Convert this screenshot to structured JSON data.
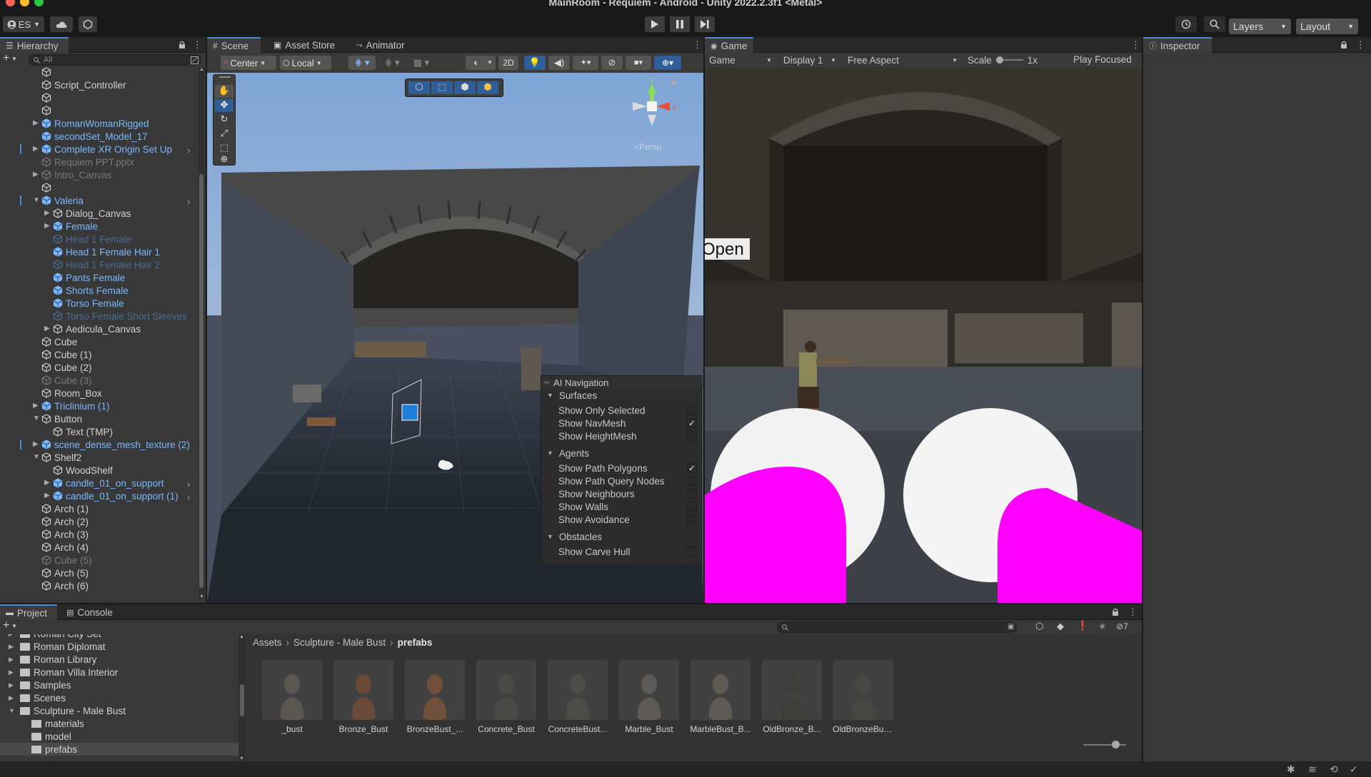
{
  "window": {
    "title": "MainRoom - Requiem - Android - Unity 2022.2.3f1 <Metal>"
  },
  "toolbar": {
    "account": "ES",
    "layers": "Layers",
    "layout": "Layout"
  },
  "hierarchy": {
    "tab": "Hierarchy",
    "search_placeholder": "All",
    "rows": [
      {
        "label": "",
        "depth": 1,
        "style": "normal"
      },
      {
        "label": "Script_Controller",
        "depth": 1,
        "style": "normal"
      },
      {
        "label": "",
        "depth": 1,
        "style": "normal"
      },
      {
        "label": "",
        "depth": 1,
        "style": "normal"
      },
      {
        "label": "RomanWomanRigged",
        "depth": 1,
        "style": "blue",
        "arrow": true
      },
      {
        "label": "secondSet_Model_17",
        "depth": 1,
        "style": "blue"
      },
      {
        "label": "Complete XR Origin Set Up",
        "depth": 1,
        "style": "blue",
        "arrow": true,
        "more": true
      },
      {
        "label": "Requiem PPT.pptx",
        "depth": 1,
        "style": "dim"
      },
      {
        "label": "Intro_Canvas",
        "depth": 1,
        "style": "dim",
        "arrow": true
      },
      {
        "label": "",
        "depth": 1,
        "style": "normal"
      },
      {
        "label": "Valeria",
        "depth": 1,
        "style": "blue",
        "arrow": true,
        "open": true,
        "more": true
      },
      {
        "label": "Dialog_Canvas",
        "depth": 2,
        "style": "normal",
        "arrow": true
      },
      {
        "label": "Female",
        "depth": 2,
        "style": "blue",
        "arrow": true
      },
      {
        "label": "Head 1 Female",
        "depth": 2,
        "style": "dimblue"
      },
      {
        "label": "Head 1 Female Hair 1",
        "depth": 2,
        "style": "blue"
      },
      {
        "label": "Head 1 Female Hair 2",
        "depth": 2,
        "style": "dimblue"
      },
      {
        "label": "Pants Female",
        "depth": 2,
        "style": "blue"
      },
      {
        "label": "Shorts Female",
        "depth": 2,
        "style": "blue"
      },
      {
        "label": "Torso Female",
        "depth": 2,
        "style": "blue"
      },
      {
        "label": "Torso Female Short Sleeves",
        "depth": 2,
        "style": "dimblue"
      },
      {
        "label": "Aedicula_Canvas",
        "depth": 2,
        "style": "normal",
        "arrow": true
      },
      {
        "label": "Cube",
        "depth": 1,
        "style": "normal"
      },
      {
        "label": "Cube (1)",
        "depth": 1,
        "style": "normal"
      },
      {
        "label": "Cube (2)",
        "depth": 1,
        "style": "normal"
      },
      {
        "label": "Cube (3)",
        "depth": 1,
        "style": "dim"
      },
      {
        "label": "Room_Box",
        "depth": 1,
        "style": "normal"
      },
      {
        "label": "Triclinium (1)",
        "depth": 1,
        "style": "blue",
        "arrow": true
      },
      {
        "label": "Button",
        "depth": 1,
        "style": "normal",
        "arrow": true,
        "open": true
      },
      {
        "label": "Text (TMP)",
        "depth": 2,
        "style": "normal"
      },
      {
        "label": "scene_dense_mesh_texture (2)",
        "depth": 1,
        "style": "blue",
        "arrow": true
      },
      {
        "label": "Shelf2",
        "depth": 1,
        "style": "normal",
        "arrow": true,
        "open": true
      },
      {
        "label": "WoodShelf",
        "depth": 2,
        "style": "normal"
      },
      {
        "label": "candle_01_on_support",
        "depth": 2,
        "style": "blue",
        "arrow": true,
        "more": true
      },
      {
        "label": "candle_01_on_support (1)",
        "depth": 2,
        "style": "blue",
        "arrow": true,
        "more": true
      },
      {
        "label": "Arch (1)",
        "depth": 1,
        "style": "normal"
      },
      {
        "label": "Arch (2)",
        "depth": 1,
        "style": "normal"
      },
      {
        "label": "Arch (3)",
        "depth": 1,
        "style": "normal"
      },
      {
        "label": "Arch (4)",
        "depth": 1,
        "style": "normal"
      },
      {
        "label": "Cube (5)",
        "depth": 1,
        "style": "dim"
      },
      {
        "label": "Arch (5)",
        "depth": 1,
        "style": "normal"
      },
      {
        "label": "Arch (6)",
        "depth": 1,
        "style": "normal"
      }
    ]
  },
  "scene": {
    "tabs": [
      "Scene",
      "Asset Store",
      "Animator"
    ],
    "pivot": "Center",
    "space": "Local",
    "mode2d": "2D",
    "persp": "Persp",
    "ai_nav": {
      "title": "AI Navigation",
      "sections": [
        {
          "name": "Surfaces",
          "items": [
            {
              "label": "Show Only Selected",
              "checked": false
            },
            {
              "label": "Show NavMesh",
              "checked": true
            },
            {
              "label": "Show HeightMesh",
              "checked": false
            }
          ]
        },
        {
          "name": "Agents",
          "items": [
            {
              "label": "Show Path Polygons",
              "checked": true
            },
            {
              "label": "Show Path Query Nodes",
              "checked": false
            },
            {
              "label": "Show Neighbours",
              "checked": false
            },
            {
              "label": "Show Walls",
              "checked": false
            },
            {
              "label": "Show Avoidance",
              "checked": false
            }
          ]
        },
        {
          "name": "Obstacles",
          "items": [
            {
              "label": "Show Carve Hull",
              "checked": false
            }
          ]
        }
      ]
    }
  },
  "game": {
    "tab": "Game",
    "view": "Game",
    "display": "Display 1",
    "aspect": "Free Aspect",
    "scale_label": "Scale",
    "scale_value": "1x",
    "play_mode": "Play Focused",
    "sign_text": "Open"
  },
  "inspector": {
    "tab": "Inspector"
  },
  "project": {
    "tabs": [
      "Project",
      "Console"
    ],
    "hidden_count": "7",
    "folders": [
      {
        "label": "Roman City Set",
        "depth": 1
      },
      {
        "label": "Roman Diplomat",
        "depth": 1
      },
      {
        "label": "Roman Library",
        "depth": 1
      },
      {
        "label": "Roman Villa Interior",
        "depth": 1
      },
      {
        "label": "Samples",
        "depth": 1
      },
      {
        "label": "Scenes",
        "depth": 1
      },
      {
        "label": "Sculpture - Male Bust",
        "depth": 1,
        "open": true
      },
      {
        "label": "materials",
        "depth": 2
      },
      {
        "label": "model",
        "depth": 2
      },
      {
        "label": "prefabs",
        "depth": 2,
        "selected": true
      }
    ],
    "breadcrumb": [
      "Assets",
      "Sculpture - Male Bust",
      "prefabs"
    ],
    "assets": [
      {
        "label": "_bust",
        "tone": "#5a5650"
      },
      {
        "label": "Bronze_Bust",
        "tone": "#6a4a36"
      },
      {
        "label": "BronzeBust_...",
        "tone": "#70503a"
      },
      {
        "label": "Concrete_Bust",
        "tone": "#4a4a48"
      },
      {
        "label": "ConcreteBust...",
        "tone": "#4c4c4a"
      },
      {
        "label": "Marble_Bust",
        "tone": "#5c5a56"
      },
      {
        "label": "MarbleBust_B...",
        "tone": "#5e5a54"
      },
      {
        "label": "OldBronze_B...",
        "tone": "#3e3e3a"
      },
      {
        "label": "OldBronzeBus...",
        "tone": "#464642"
      }
    ]
  },
  "colors": {
    "accent": "#4a8bd8",
    "prefab_blue": "#7ab8ff",
    "magenta": "#ff00ff"
  }
}
